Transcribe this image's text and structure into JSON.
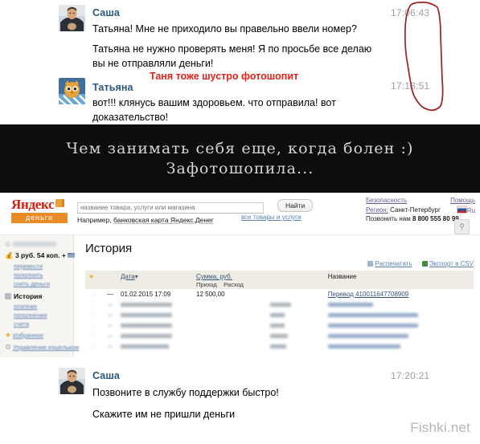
{
  "chat_top": {
    "messages": [
      {
        "sender": "Саша",
        "avatar": "man-photo-avatar",
        "timestamp": "17:06:43",
        "lines": [
          "Татьяна! Мне не приходило вы правельно ввели номер?",
          "Татьяна не нужно проверять меня! Я по просьбе все делаю",
          "вы не отправляли деньги!"
        ]
      },
      {
        "sender": "Татьяна",
        "avatar": "owl-illustration-avatar",
        "timestamp": "17:18:51",
        "lines": [
          "вот!!! клянусь вашим здоровьем. что отправила! вот",
          "доказательство!"
        ]
      }
    ],
    "annotation": {
      "text": "Таня тоже шустро фотошопит",
      "color": "#e2231a",
      "circle_color": "#9e1f1f"
    }
  },
  "banner": {
    "line1": "Чем занимать себя еще, когда болен :)",
    "line2": "Зафотошопила...",
    "bg": "#0d0d0d",
    "text_color": "#d8d8d8"
  },
  "yandex_money": {
    "logo": {
      "brand": "Яндекс",
      "badge": "деньги",
      "brand_color": "#d91d0b",
      "badge_color": "#f08a1d"
    },
    "search": {
      "placeholder": "название товара, услуги или магазина",
      "value": "",
      "hint_prefix": "Например, ",
      "hint_link": "банковская карта Яндекс.Денег",
      "button": "Найти",
      "all_goods_link": "все товары и услуги"
    },
    "top_links": {
      "security": "Безопасность",
      "help": "Помощь",
      "region_label": "Регион:",
      "region_value": "Санкт-Петербург",
      "language": "Ru",
      "call_label": "Позвонить нам",
      "phone": "8 800 555 80 99"
    },
    "sidebar": {
      "account_masked": "",
      "balance": "3 руб. 54 коп. +",
      "wallet_links": [
        "перевести",
        "пополнить",
        "снять деньги"
      ],
      "history_section": "История",
      "history_links": [
        "платежи",
        "пополнения",
        "счета"
      ],
      "favorites": "Избранное",
      "wallet_management": "Управление кошельком"
    },
    "main": {
      "title": "История",
      "print_link": "Распечатать",
      "export_link": "Экспорт в CSV",
      "columns": {
        "date": "Дата",
        "sort_marker": "▾",
        "amount": "Сумма, руб.",
        "income": "Приход",
        "expense": "Расход",
        "name": "Название"
      },
      "rows": [
        {
          "starred": false,
          "expand": "—",
          "date": "01.02.2015 17:09",
          "income": "12 500,00",
          "expense": "",
          "name": "Перевод 410011647708909",
          "blurred": false
        },
        {
          "starred": false,
          "expand": "—",
          "date": "",
          "income": "",
          "expense": "",
          "name": "",
          "blurred": true
        },
        {
          "starred": false,
          "expand": "—",
          "date": "",
          "income": "",
          "expense": "",
          "name": "",
          "blurred": true
        },
        {
          "starred": false,
          "expand": "—",
          "date": "",
          "income": "",
          "expense": "",
          "name": "",
          "blurred": true
        },
        {
          "starred": false,
          "expand": "—",
          "date": "",
          "income": "",
          "expense": "",
          "name": "",
          "blurred": true
        },
        {
          "starred": false,
          "expand": "—",
          "date": "",
          "income": "",
          "expense": "",
          "name": "",
          "blurred": true
        }
      ]
    }
  },
  "chat_bottom": {
    "sender": "Саша",
    "avatar": "man-photo-avatar",
    "timestamp": "17:20:21",
    "lines": [
      "Позвоните в службу поддержки быстро!",
      "Скажите им не пришли деньги"
    ]
  },
  "watermark": "Fishki.net"
}
